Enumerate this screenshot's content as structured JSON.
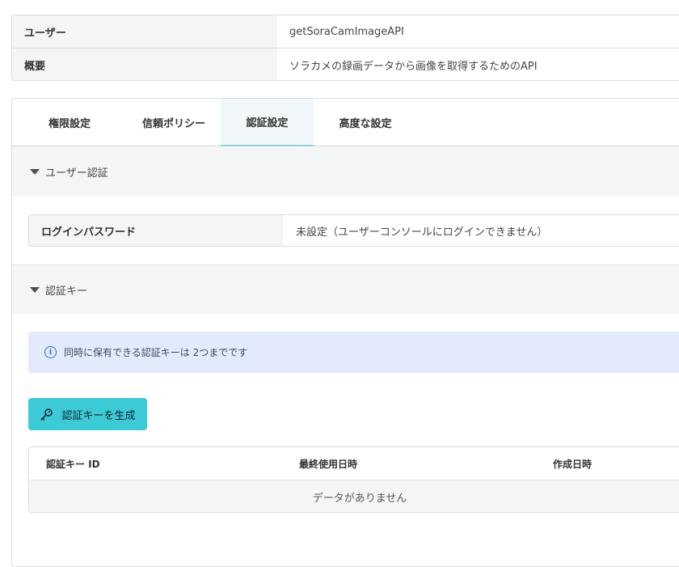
{
  "summary": {
    "rows": [
      {
        "label": "ユーザー",
        "value": "getSoraCamImageAPI"
      },
      {
        "label": "概要",
        "value": "ソラカメの録画データから画像を取得するためのAPI"
      }
    ]
  },
  "tabs": [
    {
      "label": "権限設定",
      "active": false
    },
    {
      "label": "信頼ポリシー",
      "active": false
    },
    {
      "label": "認証設定",
      "active": true
    },
    {
      "label": "高度な設定",
      "active": false
    }
  ],
  "user_auth": {
    "heading": "ユーザー認証",
    "password_label": "ログインパスワード",
    "password_value": "未設定（ユーザーコンソールにログインできません）"
  },
  "auth_keys": {
    "heading": "認証キー",
    "info_text": "同時に保有できる認証キーは 2つまでです",
    "generate_button": "認証キーを生成",
    "columns": [
      "認証キー ID",
      "最終使用日時",
      "作成日時"
    ],
    "empty_text": "データがありません"
  },
  "colors": {
    "accent": "#3ccbd6",
    "info_bg": "#e3eafb",
    "info_icon": "#2f6fd1",
    "section_bg": "#f4f5f7"
  }
}
